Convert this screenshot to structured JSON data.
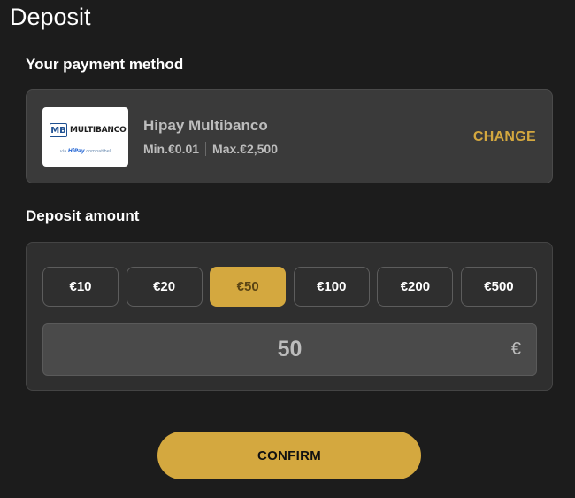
{
  "page": {
    "title": "Deposit"
  },
  "payment_method": {
    "heading": "Your payment method",
    "logo": {
      "mark": "MB",
      "name": "MULTIBANCO",
      "sub_prefix": "via",
      "sub_brand": "HiPay",
      "sub_suffix": "compatibel"
    },
    "name": "Hipay Multibanco",
    "min": "Min.€0.01",
    "max": "Max.€2,500",
    "change_label": "CHANGE",
    "accent_color": "#d4a83f"
  },
  "deposit_amount": {
    "heading": "Deposit amount",
    "options": [
      "€10",
      "€20",
      "€50",
      "€100",
      "€200",
      "€500"
    ],
    "selected": "€50",
    "input_value": "50",
    "currency": "€"
  },
  "confirm": {
    "label": "CONFIRM"
  }
}
